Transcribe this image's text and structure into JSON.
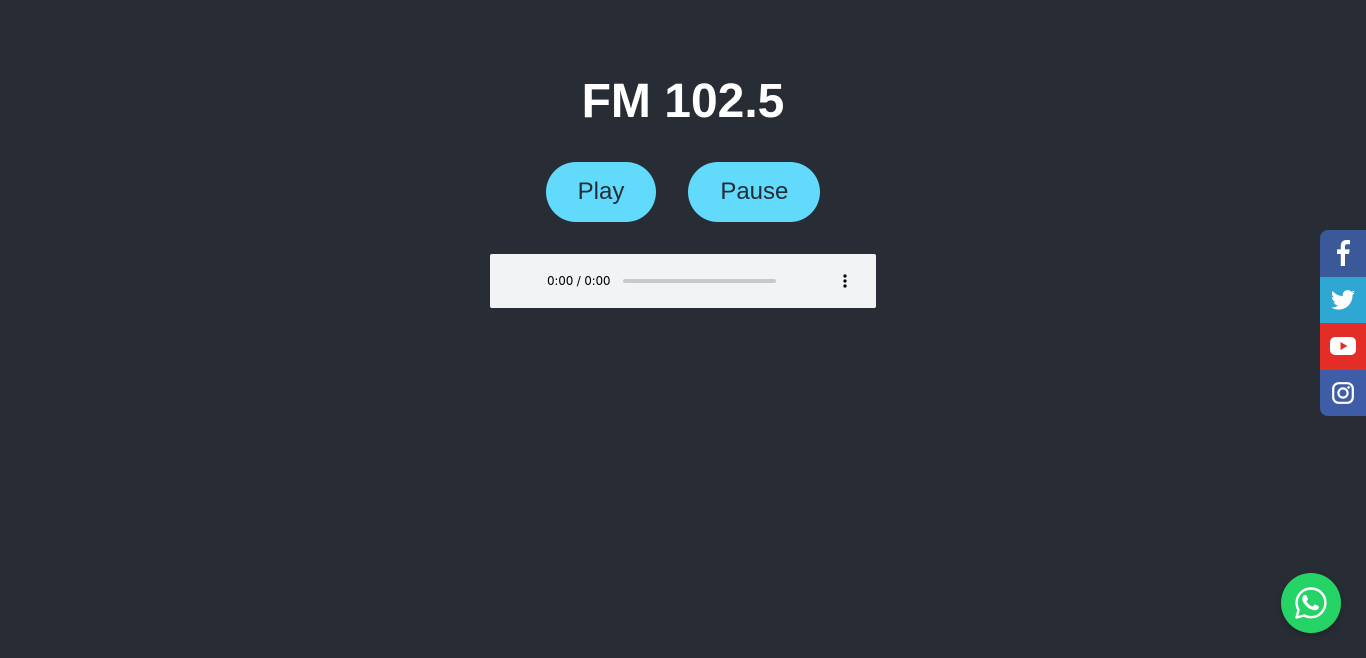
{
  "station": {
    "title": "FM 102.5"
  },
  "controls": {
    "play_label": "Play",
    "pause_label": "Pause"
  },
  "audio_player": {
    "time_display": "0:00 / 0:00",
    "progress_fraction": 0
  },
  "social": {
    "items": [
      {
        "name": "facebook",
        "icon": "facebook-icon",
        "color": "#3b5998"
      },
      {
        "name": "twitter",
        "icon": "twitter-icon",
        "color": "#2fa7d3"
      },
      {
        "name": "youtube",
        "icon": "youtube-icon",
        "color": "#e52d27"
      },
      {
        "name": "instagram",
        "icon": "instagram-icon",
        "color": "#3f5ca6"
      }
    ]
  },
  "whatsapp": {
    "icon": "whatsapp-icon",
    "color": "#25d366"
  },
  "colors": {
    "background": "#282c34",
    "accent": "#61dafb"
  }
}
